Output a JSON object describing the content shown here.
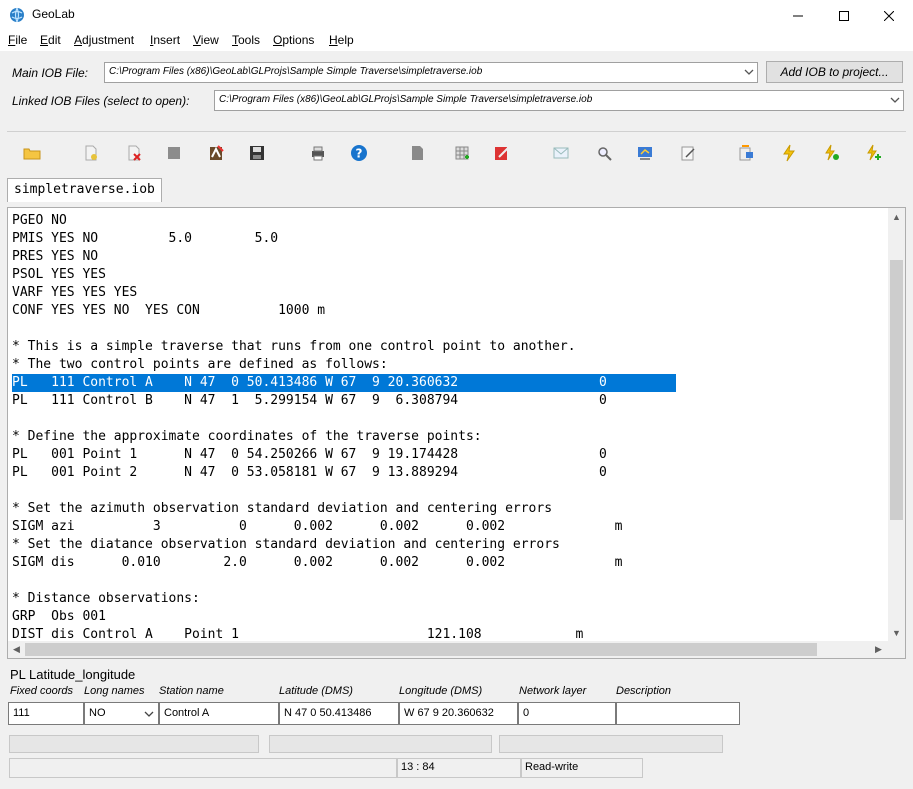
{
  "window": {
    "title": "GeoLab",
    "minimize": "—",
    "maximize": "☐",
    "close": "✕"
  },
  "menu": [
    {
      "label": "File",
      "ul": "F",
      "rest": "ile"
    },
    {
      "label": "Edit",
      "ul": "E",
      "rest": "dit"
    },
    {
      "label": "Adjustment",
      "ul": "A",
      "rest": "djustment"
    },
    {
      "label": "Insert",
      "ul": "I",
      "rest": "nsert"
    },
    {
      "label": "View",
      "ul": "V",
      "rest": "iew"
    },
    {
      "label": "Tools",
      "ul": "T",
      "rest": "ools"
    },
    {
      "label": "Options",
      "ul": "O",
      "rest": "ptions"
    },
    {
      "label": "Help",
      "ul": "H",
      "rest": "elp"
    }
  ],
  "main_iob": {
    "label": "Main IOB File:",
    "value": "C:\\Program Files (x86)\\GeoLab\\GLProjs\\Sample Simple Traverse\\simpletraverse.iob",
    "button": "Add IOB to project..."
  },
  "linked_iob": {
    "label": "Linked IOB Files (select to open):",
    "value": "C:\\Program Files (x86)\\GeoLab\\GLProjs\\Sample Simple Traverse\\simpletraverse.iob"
  },
  "toolbar_icons": [
    "open-folder-icon",
    "new-file-icon",
    "delete-file-icon",
    "stop-icon",
    "adjust-icon",
    "save-icon",
    "print-icon",
    "help-icon",
    "copy-icon",
    "grid-icon",
    "edit-report-icon",
    "mail-icon",
    "find-icon",
    "network-icon",
    "notes-icon",
    "export-icon",
    "lightning-icon",
    "run-icon",
    "add-run-icon"
  ],
  "tab": {
    "label": "simpletraverse.iob"
  },
  "editor_lines": [
    "PGEO NO",
    "PMIS YES NO         5.0        5.0",
    "PRES YES NO",
    "PSOL YES YES",
    "VARF YES YES YES",
    "CONF YES YES NO  YES CON          1000 m",
    "",
    "* This is a simple traverse that runs from one control point to another.",
    "* The two control points are defined as follows:",
    "PL   111 Control A    N 47  0 50.413486 W 67  9 20.360632                  0",
    "PL   111 Control B    N 47  1  5.299154 W 67  9  6.308794                  0",
    "",
    "* Define the approximate coordinates of the traverse points:",
    "PL   001 Point 1      N 47  0 54.250266 W 67  9 19.174428                  0",
    "PL   001 Point 2      N 47  0 53.058181 W 67  9 13.889294                  0",
    "",
    "* Set the azimuth observation standard deviation and centering errors",
    "SIGM azi          3          0      0.002      0.002      0.002              m",
    "* Set the diatance observation standard deviation and centering errors",
    "SIGM dis      0.010        2.0      0.002      0.002      0.002              m",
    "",
    "* Distance observations:",
    "GRP  Obs 001",
    "DIST dis Control A    Point 1                        121.108            m"
  ],
  "selected_line": 9,
  "record": {
    "title": "PL  Latitude_longitude",
    "headers": [
      "Fixed coords",
      "Long names",
      "Station name",
      "Latitude (DMS)",
      "Longitude (DMS)",
      "Network layer",
      "Description"
    ],
    "values": [
      "111",
      "NO",
      "Control A",
      "N 47  0 50.413486",
      "W 67  9 20.360632",
      "0",
      ""
    ]
  },
  "status": {
    "position": "13 : 84",
    "mode": "Read-write"
  }
}
